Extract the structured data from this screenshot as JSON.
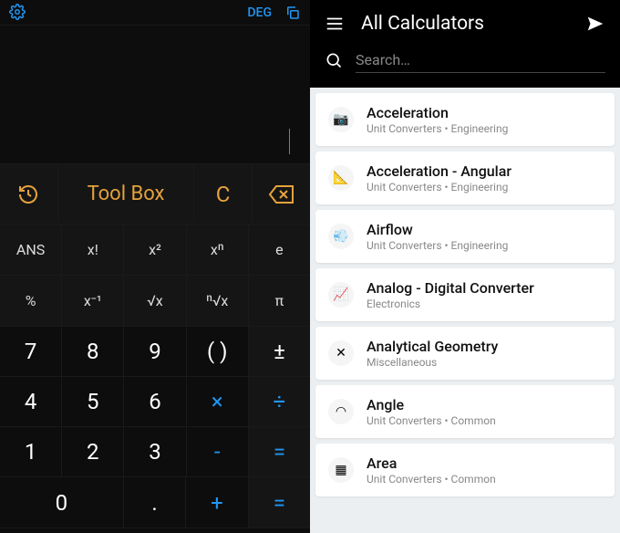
{
  "calc": {
    "deg_label": "DEG",
    "toolbox_label": "Tool Box",
    "clear_label": "C",
    "fn_rows": [
      [
        "ANS",
        "x!",
        "x²",
        "xⁿ",
        "e"
      ],
      [
        "%",
        "x⁻¹",
        "√x",
        "ⁿ√x",
        "π"
      ]
    ],
    "grid": [
      [
        "7",
        "8",
        "9",
        "( )",
        "±"
      ],
      [
        "4",
        "5",
        "6",
        "×",
        "÷"
      ],
      [
        "1",
        "2",
        "3",
        "-",
        "="
      ]
    ],
    "bottom": {
      "zero": "0",
      "dot": ".",
      "plus": "+",
      "eq": "="
    }
  },
  "list": {
    "title": "All Calculators",
    "search_placeholder": "Search…",
    "items": [
      {
        "title": "Acceleration",
        "sub": "Unit Converters • Engineering",
        "icon": "📷"
      },
      {
        "title": "Acceleration - Angular",
        "sub": "Unit Converters • Engineering",
        "icon": "📐"
      },
      {
        "title": "Airflow",
        "sub": "Unit Converters • Engineering",
        "icon": "💨"
      },
      {
        "title": "Analog - Digital Converter",
        "sub": "Electronics",
        "icon": "📈"
      },
      {
        "title": "Analytical Geometry",
        "sub": "Miscellaneous",
        "icon": "✕"
      },
      {
        "title": "Angle",
        "sub": "Unit Converters • Common",
        "icon": "◠"
      },
      {
        "title": "Area",
        "sub": "Unit Converters • Common",
        "icon": "▦"
      }
    ]
  }
}
